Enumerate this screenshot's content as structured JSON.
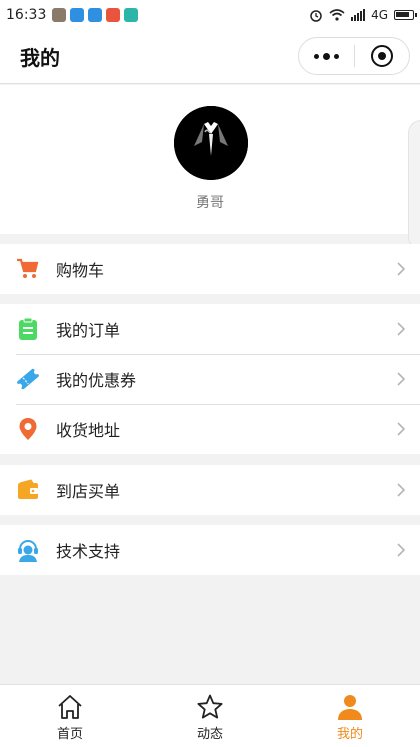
{
  "status_bar": {
    "time": "16:33",
    "network": "4G"
  },
  "header": {
    "title": "我的"
  },
  "profile": {
    "username": "勇哥"
  },
  "menu_groups": [
    [
      {
        "label": "购物车",
        "icon": "shopping-cart-icon",
        "color": "#f06a35"
      }
    ],
    [
      {
        "label": "我的订单",
        "icon": "clipboard-icon",
        "color": "#4cd964"
      },
      {
        "label": "我的优惠券",
        "icon": "coupon-ticket-icon",
        "color": "#3aa8e8"
      },
      {
        "label": "收货地址",
        "icon": "location-pin-icon",
        "color": "#f06a35"
      }
    ],
    [
      {
        "label": "到店买单",
        "icon": "wallet-icon",
        "color": "#f5a623"
      }
    ],
    [
      {
        "label": "技术支持",
        "icon": "headset-support-icon",
        "color": "#3aa8e8"
      }
    ]
  ],
  "tab_bar": {
    "items": [
      {
        "label": "首页",
        "icon": "home-icon"
      },
      {
        "label": "动态",
        "icon": "star-icon"
      },
      {
        "label": "我的",
        "icon": "person-icon"
      }
    ],
    "active": "我的",
    "active_color": "#f08a1c"
  }
}
